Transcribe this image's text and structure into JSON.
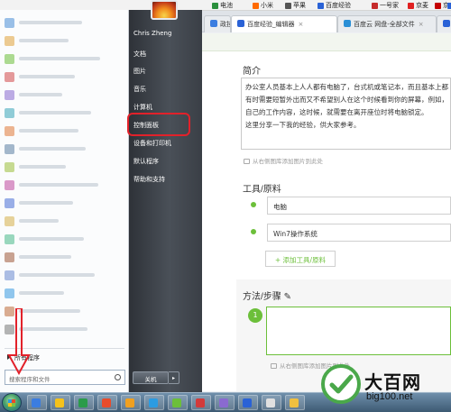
{
  "bookmarks": [
    {
      "label": "电池",
      "color": "#2a8f3c"
    },
    {
      "label": "小米",
      "color": "#ff6a00"
    },
    {
      "label": "苹果",
      "color": "#555555"
    },
    {
      "label": "百度经验",
      "color": "#2a62d6"
    },
    {
      "label": "一号家",
      "color": "#c62b2b"
    },
    {
      "label": "京麦",
      "color": "#e02020"
    },
    {
      "label": "京东",
      "color": "#c40000"
    },
    {
      "label": "历",
      "color": "#2a62d6"
    }
  ],
  "tabs": [
    {
      "label": "政技巧",
      "color": "#3b7de0"
    },
    {
      "label": "百度经验_编辑器",
      "color": "#2a62d6",
      "active": true
    },
    {
      "label": "百度云 网盘-全部文件",
      "color": "#2a8fd6"
    },
    {
      "label": "",
      "color": "#2a62d6"
    }
  ],
  "editor": {
    "intro_title": "简介",
    "intro_lines": [
      "办公室人员基本上人人都有电脑了，台式机或笔记本，而且基本上都",
      "有时需要短暂外出而又不希望别人在这个时候看到你的屏幕，例如，",
      "自己的工作内容，这时候，就需要在离开座位时将电脑锁定。",
      "这里分享一下我的经验，供大家参考。"
    ],
    "image_hint": "从右侧图库添加图片到此处",
    "tools_title": "工具/原料",
    "tools": [
      "电脑",
      "Win7操作系统"
    ],
    "add_tool": "+ 添加工具/原料",
    "steps_title": "方法/步骤",
    "step_number": "1",
    "step_image_hint": "从右侧图库添加图片到此处"
  },
  "start_menu": {
    "user_name": "Chris Zheng",
    "items": [
      "文档",
      "图片",
      "音乐",
      "计算机",
      "控制面板",
      "设备和打印机",
      "默认程序",
      "帮助和支持"
    ],
    "highlighted_item": "控制面板",
    "all_programs": "所有程序",
    "search_placeholder": "搜索程序和文件",
    "shutdown": "关机",
    "shutdown_arrow": "▸"
  },
  "program_icon_colors": [
    "#4a8fd6",
    "#e0a23a",
    "#6cbf3a",
    "#d24a4a",
    "#8a6ad0",
    "#3aa6b9",
    "#e07a3a",
    "#5d7fa3",
    "#9bbf3a",
    "#c04aa0",
    "#4a6fd6",
    "#d6b04a",
    "#4ab98a",
    "#a05a3a",
    "#6a8ad0",
    "#3a9be0",
    "#bf6c3a",
    "#7a7a7a"
  ],
  "taskbar_icon_colors": [
    "#3b7de0",
    "#f5c21b",
    "#2a9b4a",
    "#e84c2b",
    "#f0a020",
    "#2b9ce2",
    "#6cbf3a",
    "#d23a3a",
    "#8a6ad0",
    "#2a62d6",
    "#e0e0e0",
    "#f0c040"
  ],
  "watermark": {
    "title": "大百网",
    "url": "big100.net"
  }
}
